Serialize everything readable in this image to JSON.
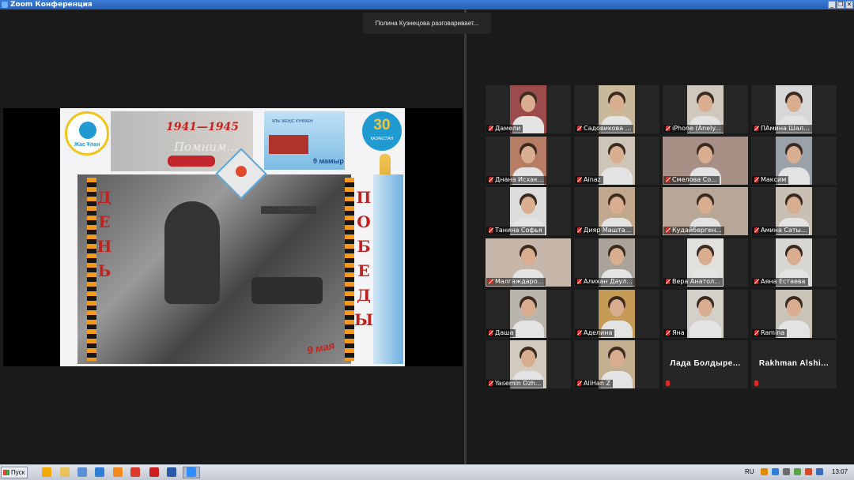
{
  "window": {
    "title": "Zoom Конференция",
    "buttons": [
      "_",
      "❐",
      "✕"
    ]
  },
  "toast": "Полина Кузнецова разговаривает...",
  "slide": {
    "years": "1941—1945",
    "remember": "Помним...",
    "emblem_text": "Жас Ұлан",
    "kz_banner_text": "ҰЛЫ ЖЕҢІС КҮНІМЕН",
    "kz_banner_date": "9 мамыр",
    "logo_number": "30",
    "logo_text": "ҚАЗАҚСТАН",
    "letters_left": [
      "Д",
      "Е",
      "Н",
      "Ь"
    ],
    "letters_right": [
      "П",
      "О",
      "Б",
      "Е",
      "Д",
      "Ы"
    ],
    "may9": "9 мая"
  },
  "participants": [
    {
      "name": "Дамели",
      "muted": true,
      "video": true,
      "wall": "#9b4b4b"
    },
    {
      "name": "Садовикова ...",
      "muted": true,
      "video": true,
      "wall": "#c9b99a"
    },
    {
      "name": "iPhone (Anely...",
      "muted": true,
      "video": true,
      "wall": "#cfc8bd"
    },
    {
      "name": "ПАмина Шал...",
      "muted": true,
      "video": true,
      "wall": "#d7d7d7"
    },
    {
      "name": "Днана Исхак...",
      "muted": true,
      "video": true,
      "wall": "#b77d64"
    },
    {
      "name": "Ainaz",
      "muted": true,
      "video": true,
      "wall": "#cfc5b6"
    },
    {
      "name": "Смелова Со...",
      "muted": true,
      "video": true,
      "wall": "#a78f86"
    },
    {
      "name": "Максим",
      "muted": true,
      "video": true,
      "wall": "#9aa1a8"
    },
    {
      "name": "Танина Софья",
      "muted": true,
      "video": true,
      "wall": "#dcdcdc"
    },
    {
      "name": "Дияр Машта...",
      "muted": true,
      "video": true,
      "wall": "#c2a98e"
    },
    {
      "name": "Кудайберген...",
      "muted": true,
      "video": true,
      "wall": "#b8a797"
    },
    {
      "name": "Амина Саты...",
      "muted": true,
      "video": true,
      "wall": "#c9c0b3"
    },
    {
      "name": "Малгаждаро...",
      "muted": true,
      "video": true,
      "wall": "#c6b7aa"
    },
    {
      "name": "Алихан Даул...",
      "muted": true,
      "video": true,
      "wall": "#a9a39a"
    },
    {
      "name": "Вера Анатол...",
      "muted": true,
      "video": true,
      "wall": "#e2e0dc"
    },
    {
      "name": "Аяна Естаева",
      "muted": true,
      "video": true,
      "wall": "#d8d6d2"
    },
    {
      "name": "Даша",
      "muted": true,
      "video": true,
      "wall": "#b9b5ad"
    },
    {
      "name": "Аделина",
      "muted": true,
      "video": true,
      "wall": "#c59a55"
    },
    {
      "name": "Яна",
      "muted": true,
      "video": true,
      "wall": "#d3cfc9"
    },
    {
      "name": "Ramina",
      "muted": true,
      "video": true,
      "wall": "#c9c3b8"
    },
    {
      "name": "Yasemin Dzh...",
      "muted": true,
      "video": true,
      "wall": "#d3cbbe"
    },
    {
      "name": "AliHan Z",
      "muted": true,
      "video": true,
      "wall": "#c4b08f"
    },
    {
      "name": "Лада  Болдыре...",
      "muted": true,
      "video": false
    },
    {
      "name": "Rakhman  Alshi...",
      "muted": true,
      "video": false
    }
  ],
  "taskbar": {
    "start_label": "Пуск",
    "lang": "RU",
    "clock": "13:07",
    "app_icons": [
      {
        "name": "chrome-like-icon",
        "color": "#f2a900"
      },
      {
        "name": "folder-icon",
        "color": "#e8c15a"
      },
      {
        "name": "explorer-icon",
        "color": "#5b8fd6"
      },
      {
        "name": "play-icon",
        "color": "#2f7fd9"
      },
      {
        "name": "media-icon",
        "color": "#f08a1c"
      },
      {
        "name": "browser-icon",
        "color": "#d93a2b"
      },
      {
        "name": "opera-icon",
        "color": "#cc1f1f"
      },
      {
        "name": "word-icon",
        "color": "#2b5aa8"
      },
      {
        "name": "zoom-icon",
        "color": "#2d8cff"
      }
    ],
    "tray_icons": [
      {
        "name": "help-icon",
        "color": "#e08a00"
      },
      {
        "name": "network-icon",
        "color": "#2f7fd9"
      },
      {
        "name": "volume-icon",
        "color": "#6c6c6c"
      },
      {
        "name": "battery-icon",
        "color": "#5aa34a"
      },
      {
        "name": "security-icon",
        "color": "#d64a2a"
      },
      {
        "name": "update-icon",
        "color": "#3b6dbf"
      }
    ]
  }
}
